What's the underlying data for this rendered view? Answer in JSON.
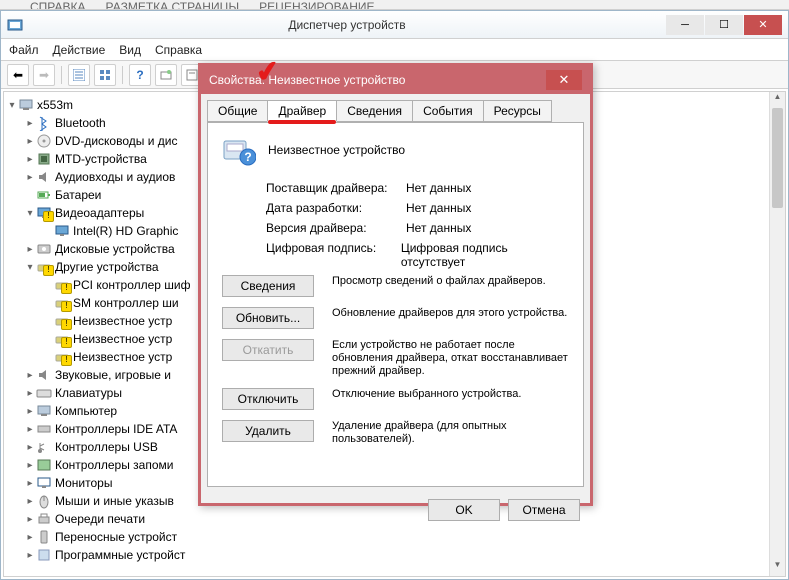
{
  "ribbon": {
    "items": [
      "СПРАВКА",
      "РАЗМЕТКА СТРАНИЦЫ",
      "РЕЦЕНЗИРОВАНИЕ"
    ]
  },
  "main": {
    "title": "Диспетчер устройств",
    "menu": [
      "Файл",
      "Действие",
      "Вид",
      "Справка"
    ]
  },
  "tree": {
    "root": "x553m",
    "items": [
      {
        "d": 1,
        "exp": "▸",
        "icon": "bluetooth",
        "label": "Bluetooth"
      },
      {
        "d": 1,
        "exp": "▸",
        "icon": "disc",
        "label": "DVD-дисководы и дис"
      },
      {
        "d": 1,
        "exp": "▸",
        "icon": "chip",
        "label": "MTD-устройства"
      },
      {
        "d": 1,
        "exp": "▸",
        "icon": "audio",
        "label": "Аудиовходы и аудиов"
      },
      {
        "d": 1,
        "exp": " ",
        "icon": "battery",
        "label": "Батареи"
      },
      {
        "d": 1,
        "exp": "▾",
        "icon": "display",
        "label": "Видеоадаптеры",
        "warn": true
      },
      {
        "d": 2,
        "exp": " ",
        "icon": "display",
        "label": "Intel(R) HD Graphic"
      },
      {
        "d": 1,
        "exp": "▸",
        "icon": "disk",
        "label": "Дисковые устройства"
      },
      {
        "d": 1,
        "exp": "▾",
        "icon": "other",
        "label": "Другие устройства",
        "warn": true
      },
      {
        "d": 2,
        "exp": " ",
        "icon": "other",
        "label": "PCI контроллер шиф",
        "warn": true
      },
      {
        "d": 2,
        "exp": " ",
        "icon": "other",
        "label": "SM контроллер ши",
        "warn": true
      },
      {
        "d": 2,
        "exp": " ",
        "icon": "other",
        "label": "Неизвестное устр",
        "warn": true
      },
      {
        "d": 2,
        "exp": " ",
        "icon": "other",
        "label": "Неизвестное устр",
        "warn": true
      },
      {
        "d": 2,
        "exp": " ",
        "icon": "other",
        "label": "Неизвестное устр",
        "warn": true
      },
      {
        "d": 1,
        "exp": "▸",
        "icon": "audio",
        "label": "Звуковые, игровые и"
      },
      {
        "d": 1,
        "exp": "▸",
        "icon": "keyboard",
        "label": "Клавиатуры"
      },
      {
        "d": 1,
        "exp": "▸",
        "icon": "computer",
        "label": "Компьютер"
      },
      {
        "d": 1,
        "exp": "▸",
        "icon": "ide",
        "label": "Контроллеры IDE ATA"
      },
      {
        "d": 1,
        "exp": "▸",
        "icon": "usb",
        "label": "Контроллеры USB"
      },
      {
        "d": 1,
        "exp": "▸",
        "icon": "storage",
        "label": "Контроллеры запоми"
      },
      {
        "d": 1,
        "exp": "▸",
        "icon": "monitor",
        "label": "Мониторы"
      },
      {
        "d": 1,
        "exp": "▸",
        "icon": "mouse",
        "label": "Мыши и иные указыв"
      },
      {
        "d": 1,
        "exp": "▸",
        "icon": "printer",
        "label": "Очереди печати"
      },
      {
        "d": 1,
        "exp": "▸",
        "icon": "portable",
        "label": "Переносные устройст"
      },
      {
        "d": 1,
        "exp": "▸",
        "icon": "software",
        "label": "Программные устройст"
      }
    ]
  },
  "dialog": {
    "title": "Свойства: Неизвестное устройство",
    "tabs": [
      "Общие",
      "Драйвер",
      "Сведения",
      "События",
      "Ресурсы"
    ],
    "active_tab": 1,
    "device_name": "Неизвестное устройство",
    "info": [
      {
        "k": "Поставщик драйвера:",
        "v": "Нет данных"
      },
      {
        "k": "Дата разработки:",
        "v": "Нет данных"
      },
      {
        "k": "Версия драйвера:",
        "v": "Нет данных"
      },
      {
        "k": "Цифровая подпись:",
        "v": "Цифровая подпись отсутствует"
      }
    ],
    "buttons": [
      {
        "label": "Сведения",
        "desc": "Просмотр сведений о файлах драйверов.",
        "disabled": false
      },
      {
        "label": "Обновить...",
        "desc": "Обновление драйверов для этого устройства.",
        "disabled": false
      },
      {
        "label": "Откатить",
        "desc": "Если устройство не работает после обновления драйвера, откат восстанавливает прежний драйвер.",
        "disabled": true
      },
      {
        "label": "Отключить",
        "desc": "Отключение выбранного устройства.",
        "disabled": false
      },
      {
        "label": "Удалить",
        "desc": "Удаление драйвера (для опытных пользователей).",
        "disabled": false
      }
    ],
    "footer": {
      "ok": "OK",
      "cancel": "Отмена"
    }
  }
}
